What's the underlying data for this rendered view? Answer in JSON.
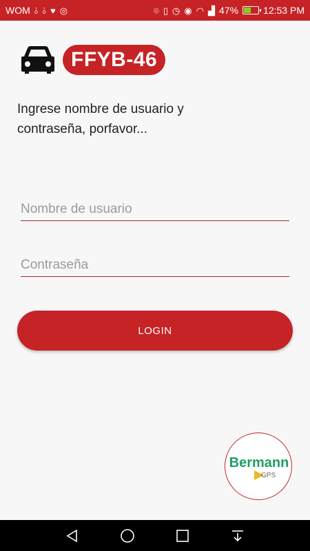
{
  "status_bar": {
    "carrier": "WOM",
    "battery_percent": "47%",
    "battery_level": 0.47,
    "time": "12:53 PM",
    "icons": [
      "usb-icon",
      "usb-icon",
      "heart-rate-icon",
      "whatsapp-icon",
      "location-icon",
      "vibrate-icon",
      "alarm-icon",
      "eye-icon",
      "wifi-icon",
      "signal-icon",
      "battery-icon"
    ]
  },
  "header": {
    "plate": "FFYB-46",
    "icon": "car-icon"
  },
  "instructions": "Ingrese nombre de usuario y contraseña, porfavor...",
  "form": {
    "username_placeholder": "Nombre de usuario",
    "password_placeholder": "Contraseña",
    "login_label": "LOGIN"
  },
  "logo": {
    "name": "Bermann",
    "sub": "GPS"
  },
  "nav": {
    "buttons": [
      "back-icon",
      "home-icon",
      "recents-icon",
      "notifications-pull-icon"
    ]
  },
  "colors": {
    "accent": "#c62326",
    "background": "#f7f7f7",
    "logo_green": "#1f9e67"
  }
}
